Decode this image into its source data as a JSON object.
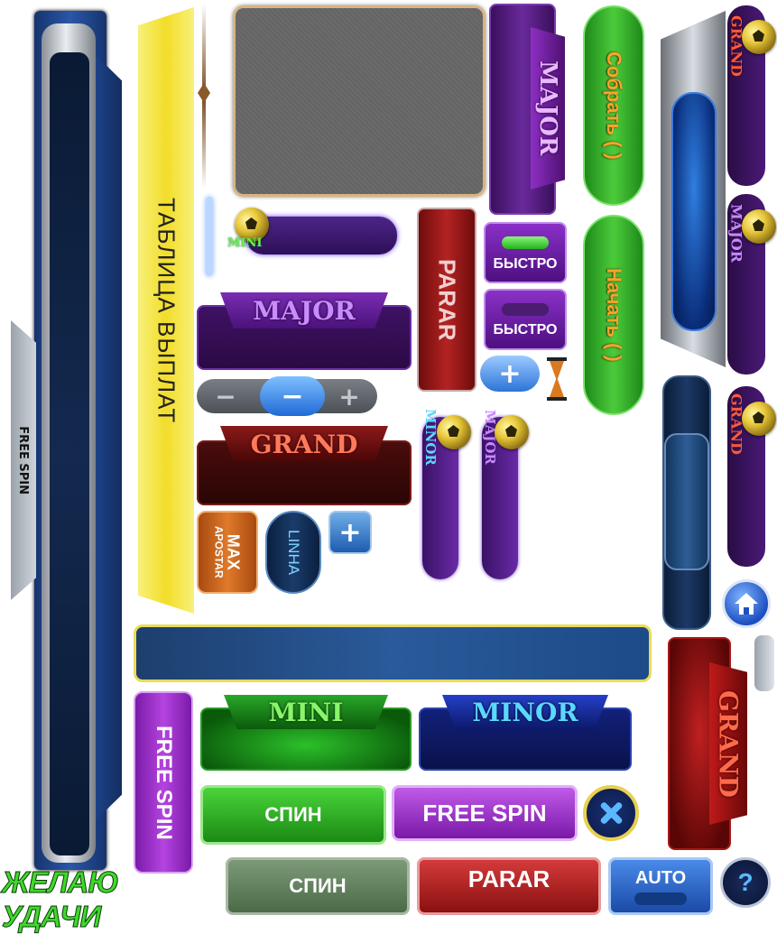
{
  "free_spin_side": "FREE SPIN",
  "paytable": "ТАБЛИЦА ВЫПЛАТ",
  "collect": "Собрать (   )",
  "start": "Начать (   )",
  "major": "MAJOR",
  "minor": "MINOR",
  "mini": "MINI",
  "grand": "GRAND",
  "parar": "PARAR",
  "fast": "БЫСТРО",
  "max_line1": "MAX",
  "max_line2": "APOSTAR",
  "linha": "LINHA",
  "free_spin": "FREE SPIN",
  "spin": "СПИН",
  "auto": "AUTO",
  "wish": "ЖЕЛАЮ УДАЧИ",
  "help": "?",
  "plus": "+",
  "minus": "−",
  "colors": {
    "purple": "#5a1c86",
    "green": "#2fa82b",
    "red": "#8e1414",
    "blue": "#1f3f8a",
    "yellow": "#f6e93a"
  }
}
